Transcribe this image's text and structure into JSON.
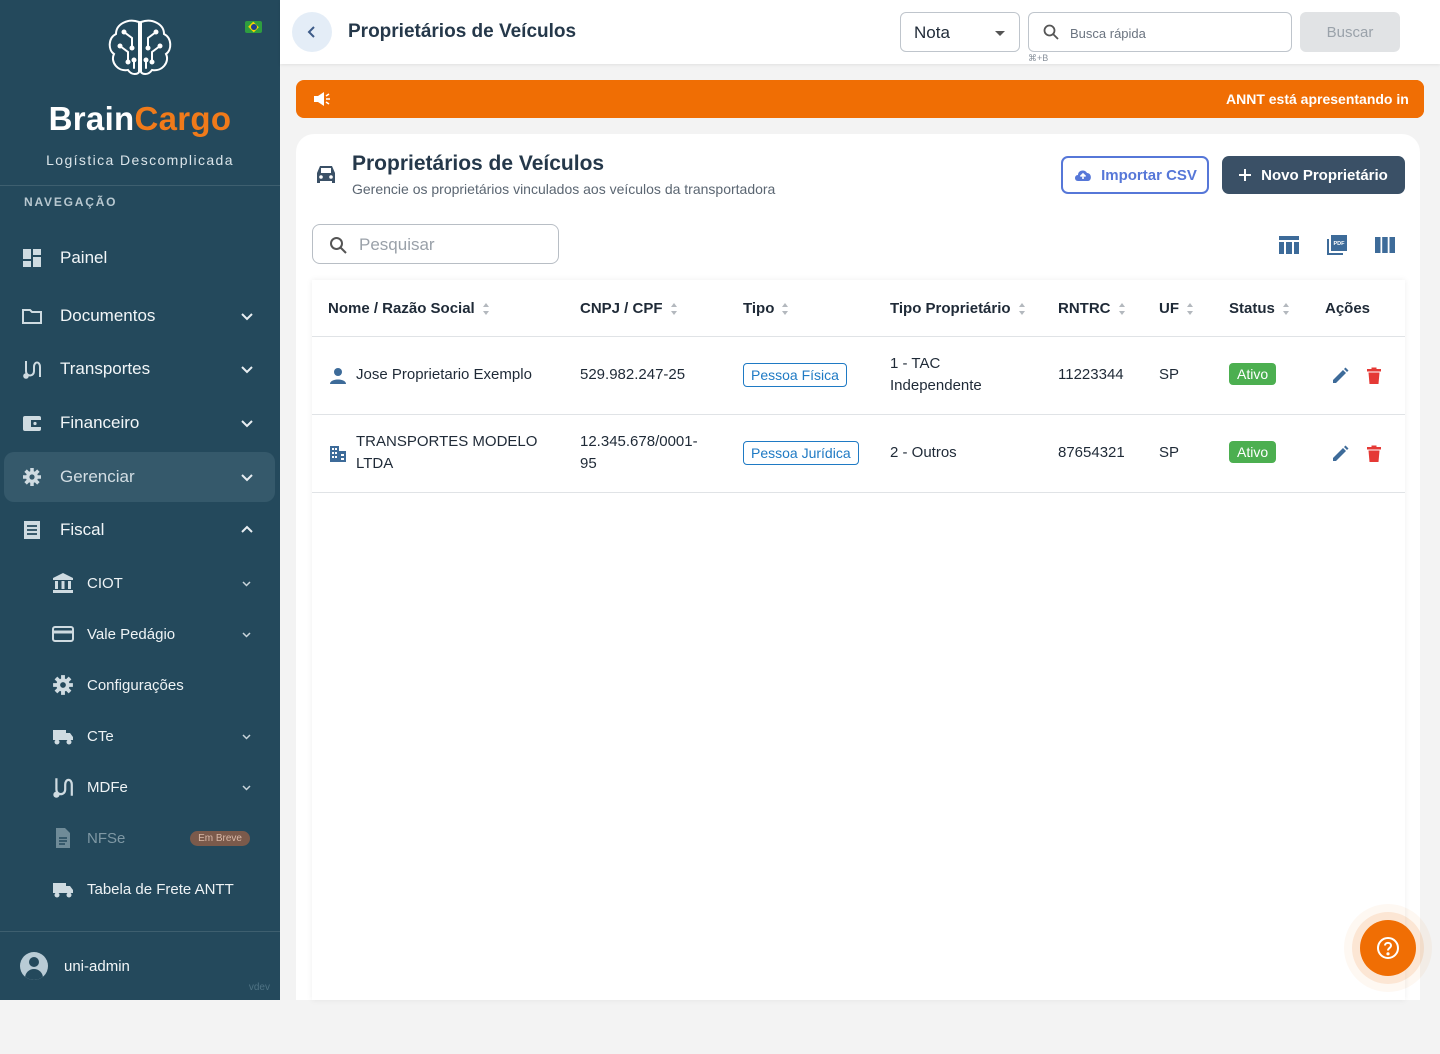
{
  "sidebar": {
    "brand_part1": "Brain",
    "brand_part2": "Cargo",
    "tagline": "Logística Descomplicada",
    "section_label": "NAVEGAÇÃO",
    "items": {
      "painel": "Painel",
      "documentos": "Documentos",
      "transportes": "Transportes",
      "financeiro": "Financeiro",
      "gerenciar": "Gerenciar",
      "fiscal": "Fiscal"
    },
    "fiscal_sub": {
      "ciot": "CIOT",
      "vale_pedagio": "Vale Pedágio",
      "configuracoes": "Configurações",
      "cte": "CTe",
      "mdfe": "MDFe",
      "nfse": "NFSe",
      "nfse_badge": "Em Breve",
      "tabela_frete": "Tabela de Frete ANTT"
    },
    "user_name": "uni-admin",
    "version": "vdev"
  },
  "topbar": {
    "title": "Proprietários de Veículos",
    "select_value": "Nota",
    "search_placeholder": "Busca rápida",
    "shortcut": "⌘+B",
    "search_button": "Buscar"
  },
  "announcement": {
    "text": "ANNT está apresentando instabilidade"
  },
  "card": {
    "title": "Proprietários de Veículos",
    "subtitle": "Gerencie os proprietários vinculados aos veículos da transportadora",
    "import_button": "Importar CSV",
    "new_button": "Novo Proprietário",
    "search_placeholder": "Pesquisar"
  },
  "table": {
    "columns": [
      "Nome / Razão Social",
      "CNPJ / CPF",
      "Tipo",
      "Tipo Proprietário",
      "RNTRC",
      "UF",
      "Status",
      "Ações"
    ],
    "rows": [
      {
        "nome": "Jose Proprietario Exemplo",
        "nome_l2": "",
        "doc": "529.982.247-25",
        "doc_l2": "",
        "tipo": "Pessoa Física",
        "tipo_prop": "1 - TAC",
        "tipo_prop_l2": "Independente",
        "rntrc": "11223344",
        "uf": "SP",
        "status": "Ativo"
      },
      {
        "nome": "TRANSPORTES MODELO",
        "nome_l2": "LTDA",
        "doc": "12.345.678/0001-",
        "doc_l2": "95",
        "tipo": "Pessoa Jurídica",
        "tipo_prop": "2 - Outros",
        "tipo_prop_l2": "",
        "rntrc": "87654321",
        "uf": "SP",
        "status": "Ativo"
      }
    ]
  },
  "colors": {
    "sidebar_bg": "#24495c",
    "accent_orange": "#f06e04",
    "primary_dark": "#3a5066",
    "link_blue": "#1f7ac4",
    "status_green": "#4caf50",
    "delete_red": "#e53935"
  },
  "icons": {
    "sidebar": [
      "brain-icon",
      "brazil-flag-icon",
      "dashboard-icon",
      "folder-icon",
      "route-icon",
      "wallet-icon",
      "gear-icon",
      "receipt-icon",
      "bank-icon",
      "credit-card-icon",
      "truck-icon",
      "file-icon",
      "user-avatar-icon"
    ],
    "toolbar": [
      "table-view-icon",
      "pdf-export-icon",
      "columns-icon"
    ],
    "rows": [
      "person-icon",
      "building-icon",
      "edit-icon",
      "delete-icon"
    ]
  }
}
